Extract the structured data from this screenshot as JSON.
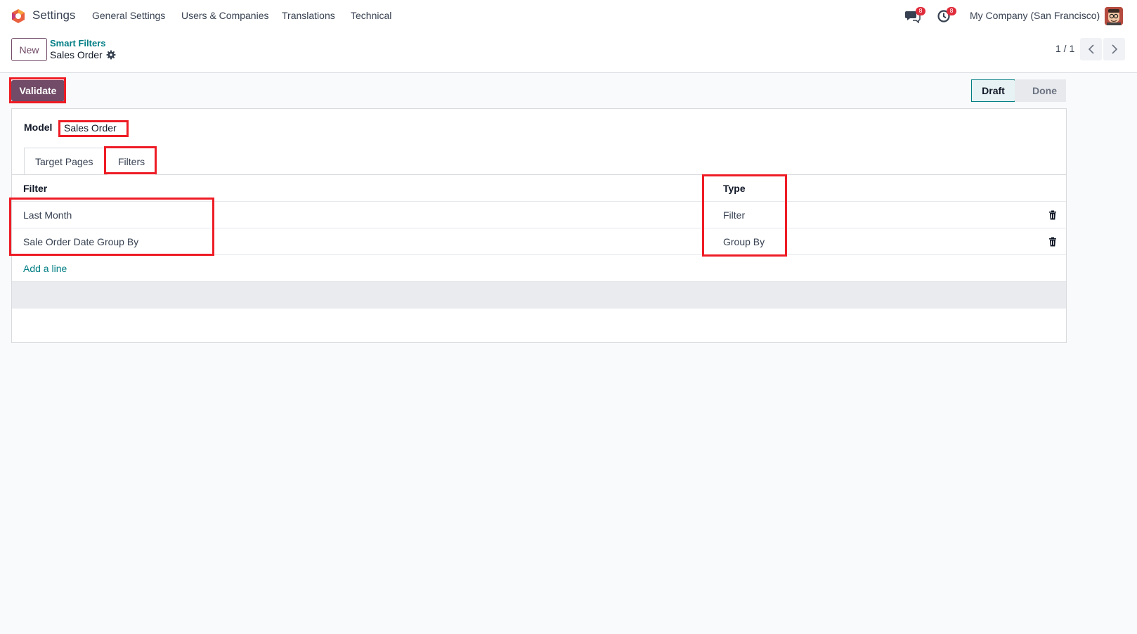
{
  "navbar": {
    "app_name": "Settings",
    "menu": [
      "General Settings",
      "Users & Companies",
      "Translations",
      "Technical"
    ],
    "messages_badge": "8",
    "activities_badge": "8",
    "company": "My Company (San Francisco)"
  },
  "control_panel": {
    "new_label": "New",
    "breadcrumb_parent": "Smart Filters",
    "breadcrumb_current": "Sales Order",
    "pager": "1 / 1"
  },
  "statusbar": {
    "validate_label": "Validate",
    "stages": [
      "Draft",
      "Done"
    ],
    "active_stage": "Draft"
  },
  "form": {
    "model_label": "Model",
    "model_value": "Sales Order",
    "tabs": [
      "Target Pages",
      "Filters"
    ],
    "active_tab": "Filters",
    "table": {
      "headers": [
        "Filter",
        "Type"
      ],
      "rows": [
        {
          "filter": "Last Month",
          "type": "Filter"
        },
        {
          "filter": "Sale Order Date Group By",
          "type": "Group By"
        }
      ],
      "add_line": "Add a line"
    }
  },
  "colors": {
    "brand": "#714b67",
    "link": "#017e84",
    "annotation": "#ee1c25"
  }
}
